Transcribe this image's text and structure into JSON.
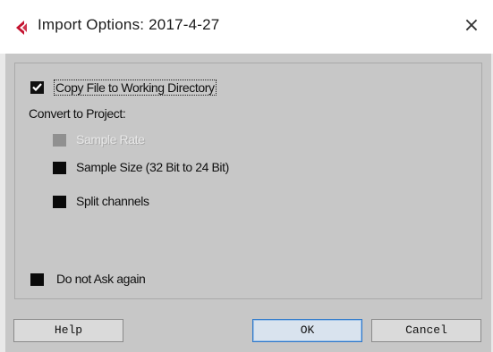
{
  "window": {
    "title": "Import Options: 2017-4-27",
    "close_glyph": "×",
    "app_icon": "cubase-logo-icon"
  },
  "options": {
    "copy_file": {
      "label": "Copy File to Working Directory",
      "checked": true
    },
    "convert_heading": "Convert to Project:",
    "sample_rate": {
      "label": "Sample Rate",
      "checked": false,
      "enabled": false
    },
    "sample_size": {
      "label": "Sample Size (32 Bit to 24 Bit)",
      "checked": false,
      "enabled": true
    },
    "split_channels": {
      "label": "Split channels",
      "checked": false,
      "enabled": true
    },
    "do_not_ask": {
      "label": "Do not Ask again",
      "checked": false
    }
  },
  "buttons": {
    "help": "Help",
    "ok": "OK",
    "cancel": "Cancel"
  },
  "colors": {
    "dialog_bg": "#c7c7c7",
    "accent_red": "#c4122f",
    "default_button_border": "#2e78c9"
  }
}
